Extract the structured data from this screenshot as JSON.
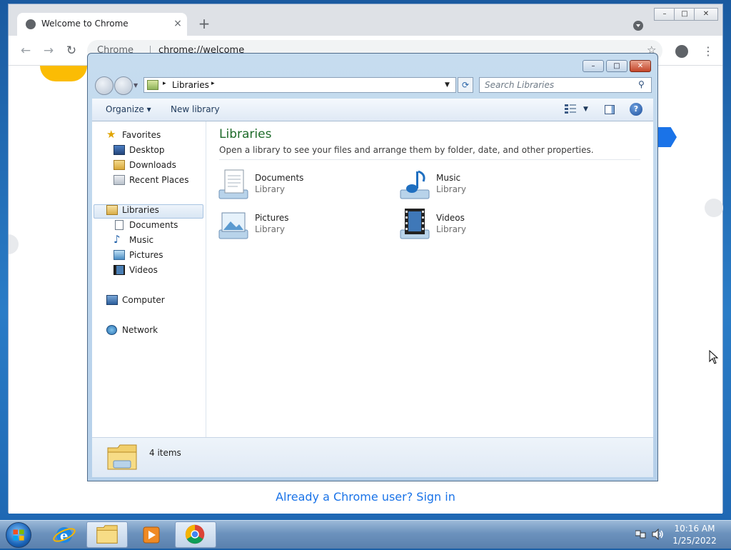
{
  "chrome": {
    "tab_title": "Welcome to Chrome",
    "tab_close": "×",
    "new_tab": "+",
    "omnibox_chip": "Chrome",
    "omnibox_url": "chrome://welcome",
    "star": "☆",
    "menu": "⋮",
    "back": "←",
    "forward": "→",
    "reload": "↻",
    "signin_text": "Already a Chrome user? Sign in",
    "caption_min": "–",
    "caption_max": "□",
    "caption_close": "✕"
  },
  "explorer": {
    "caption_min": "–",
    "caption_max": "□",
    "caption_close": "✕",
    "address": {
      "arrow1": "▸",
      "text": "Libraries",
      "arrow2": "▸",
      "drop": "▼"
    },
    "refresh": "⟳",
    "search_placeholder": "Search Libraries",
    "search_icon": "⚲",
    "commands": {
      "organize": "Organize ▾",
      "new_library": "New library",
      "views_drop": "▼",
      "help": "?"
    },
    "nav": {
      "favorites": "Favorites",
      "desktop": "Desktop",
      "downloads": "Downloads",
      "recent": "Recent Places",
      "libraries": "Libraries",
      "documents": "Documents",
      "music": "Music",
      "pictures": "Pictures",
      "videos": "Videos",
      "computer": "Computer",
      "network": "Network"
    },
    "content": {
      "title": "Libraries",
      "description": "Open a library to see your files and arrange them by folder, date, and other properties.",
      "items": [
        {
          "name": "Documents",
          "type": "Library"
        },
        {
          "name": "Music",
          "type": "Library"
        },
        {
          "name": "Pictures",
          "type": "Library"
        },
        {
          "name": "Videos",
          "type": "Library"
        }
      ]
    },
    "status": "4 items"
  },
  "taskbar": {
    "time": "10:16 AM",
    "date": "1/25/2022"
  },
  "colors": {
    "chrome_link": "#1a73e8",
    "libraries_title": "#1e6b2a",
    "explorer_frame": "#b6d0ea",
    "taskbar": "#6c92bd"
  }
}
